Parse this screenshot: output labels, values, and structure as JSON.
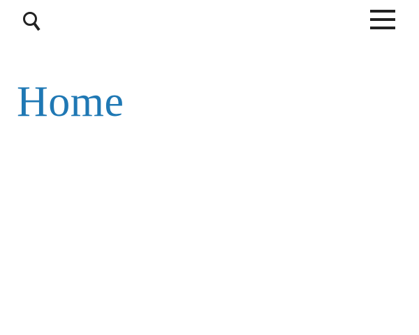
{
  "header": {
    "search_icon": "search-icon",
    "menu_icon": "hamburger-menu-icon"
  },
  "main": {
    "title": "Home"
  },
  "colors": {
    "title": "#1f78b4",
    "icon": "#222222",
    "background": "#ffffff"
  }
}
